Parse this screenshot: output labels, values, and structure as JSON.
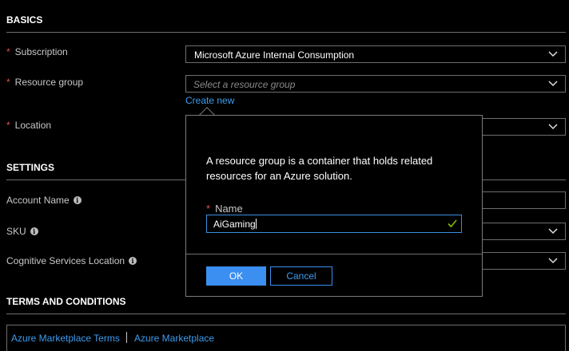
{
  "sections": {
    "basics": "BASICS",
    "settings": "SETTINGS",
    "terms": "TERMS AND CONDITIONS"
  },
  "required_marker": "*",
  "fields": {
    "subscription": {
      "label": "Subscription",
      "value": "Microsoft Azure Internal Consumption"
    },
    "resource_group": {
      "label": "Resource group",
      "placeholder": "Select a resource group",
      "create_new": "Create new"
    },
    "location": {
      "label": "Location"
    },
    "account_name": {
      "label": "Account Name"
    },
    "sku": {
      "label": "SKU"
    },
    "cognitive_location": {
      "label": "Cognitive Services Location"
    }
  },
  "popover": {
    "description": "A resource group is a container that holds related resources for an Azure solution.",
    "name_label": "Name",
    "name_value": "AiGaming",
    "ok_label": "OK",
    "cancel_label": "Cancel"
  },
  "terms": {
    "link1": "Azure Marketplace Terms",
    "link2": "Azure Marketplace"
  },
  "icons": {
    "info": "info-icon",
    "chevron": "chevron-down-icon",
    "check": "check-icon"
  },
  "colors": {
    "background": "#000000",
    "accent": "#3b8ff0",
    "required": "#e0504a",
    "valid": "#7fba00"
  }
}
